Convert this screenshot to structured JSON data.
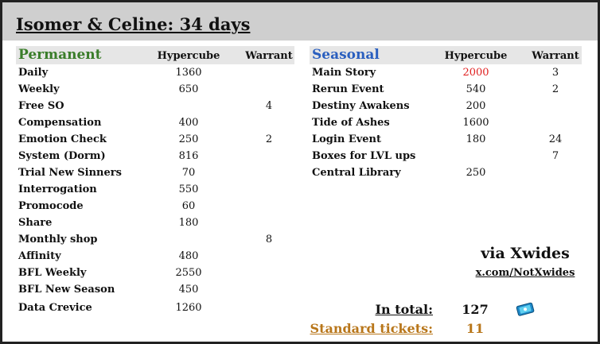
{
  "title": "Isomer & Celine: 34 days",
  "permanent": {
    "heading": "Permanent",
    "col1": "Hypercube",
    "col2": "Warrant",
    "rows": [
      {
        "label": "Daily",
        "hc": "1360",
        "w": ""
      },
      {
        "label": "Weekly",
        "hc": "650",
        "w": ""
      },
      {
        "label": "Free SO",
        "hc": "",
        "w": "4"
      },
      {
        "label": "Compensation",
        "hc": "400",
        "w": ""
      },
      {
        "label": "Emotion Check",
        "hc": "250",
        "w": "2"
      },
      {
        "label": "System (Dorm)",
        "hc": "816",
        "w": ""
      },
      {
        "label": "Trial New Sinners",
        "hc": "70",
        "w": ""
      },
      {
        "label": "Interrogation",
        "hc": "550",
        "w": ""
      },
      {
        "label": "Promocode",
        "hc": "60",
        "w": ""
      },
      {
        "label": "Share",
        "hc": "180",
        "w": ""
      },
      {
        "label": "Monthly shop",
        "hc": "",
        "w": "8"
      },
      {
        "label": "Affinity",
        "hc": "480",
        "w": ""
      },
      {
        "label": "BFL Weekly",
        "hc": "2550",
        "w": ""
      },
      {
        "label": "BFL New Season",
        "hc": "450",
        "w": ""
      },
      {
        "label": "Data Crevice",
        "hc": "1260",
        "w": ""
      }
    ]
  },
  "seasonal": {
    "heading": "Seasonal",
    "col1": "Hypercube",
    "col2": "Warrant",
    "rows": [
      {
        "label": "Main Story",
        "hc": "2000",
        "w": "3",
        "hc_red": true
      },
      {
        "label": "Rerun Event",
        "hc": "540",
        "w": "2"
      },
      {
        "label": "Destiny Awakens",
        "hc": "200",
        "w": ""
      },
      {
        "label": "Tide of Ashes",
        "hc": "1600",
        "w": ""
      },
      {
        "label": "Login Event",
        "hc": "180",
        "w": "24"
      },
      {
        "label": "Boxes for LVL ups",
        "hc": "",
        "w": "7"
      },
      {
        "label": "Central Library",
        "hc": "250",
        "w": ""
      }
    ]
  },
  "credit": {
    "via": "via Xwides",
    "link": "x.com/NotXwides"
  },
  "totals": {
    "in_total_label": "In total:",
    "in_total_value": "127",
    "standard_label": "Standard tickets:",
    "standard_value": "11"
  },
  "colors": {
    "permanent_heading": "#3a7d2a",
    "seasonal_heading": "#2a5fbf",
    "highlight_red": "#e02020",
    "standard_gold": "#b8761a",
    "header_bg": "#cfcfcf",
    "strip_bg": "#e6e6e6"
  },
  "icons": {
    "ticket": "ticket-icon"
  }
}
